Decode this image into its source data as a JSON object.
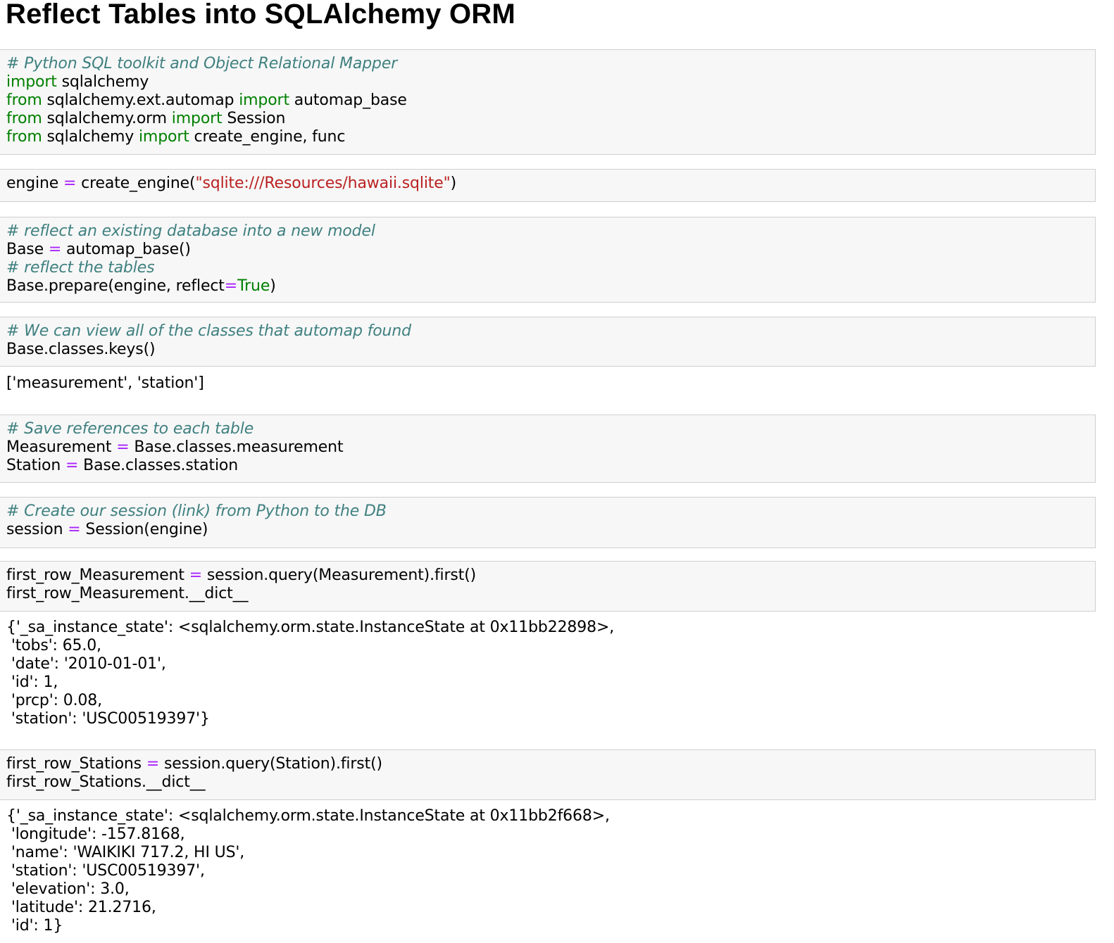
{
  "title": "Reflect Tables into SQLAlchemy ORM",
  "colors": {
    "comment": "#408080",
    "keyword": "#008000",
    "operator": "#aa22ff",
    "string": "#ba2121",
    "cell_background": "#f7f7f7",
    "cell_border": "#cfcfcf"
  },
  "cells": [
    {
      "input": [
        [
          {
            "t": "comment",
            "v": "# Python SQL toolkit and Object Relational Mapper"
          }
        ],
        [
          {
            "t": "kw",
            "v": "import"
          },
          {
            "t": "txt",
            "v": " sqlalchemy"
          }
        ],
        [
          {
            "t": "kw",
            "v": "from"
          },
          {
            "t": "txt",
            "v": " sqlalchemy.ext.automap "
          },
          {
            "t": "kw",
            "v": "import"
          },
          {
            "t": "txt",
            "v": " automap_base"
          }
        ],
        [
          {
            "t": "kw",
            "v": "from"
          },
          {
            "t": "txt",
            "v": " sqlalchemy.orm "
          },
          {
            "t": "kw",
            "v": "import"
          },
          {
            "t": "txt",
            "v": " Session"
          }
        ],
        [
          {
            "t": "kw",
            "v": "from"
          },
          {
            "t": "txt",
            "v": " sqlalchemy "
          },
          {
            "t": "kw",
            "v": "import"
          },
          {
            "t": "txt",
            "v": " create_engine, func"
          }
        ]
      ],
      "output": []
    },
    {
      "input": [
        [
          {
            "t": "txt",
            "v": "engine "
          },
          {
            "t": "op",
            "v": "="
          },
          {
            "t": "txt",
            "v": " create_engine("
          },
          {
            "t": "str",
            "v": "\"sqlite:///Resources/hawaii.sqlite\""
          },
          {
            "t": "txt",
            "v": ")"
          }
        ]
      ],
      "output": []
    },
    {
      "input": [
        [
          {
            "t": "comment",
            "v": "# reflect an existing database into a new model"
          }
        ],
        [
          {
            "t": "txt",
            "v": "Base "
          },
          {
            "t": "op",
            "v": "="
          },
          {
            "t": "txt",
            "v": " automap_base()"
          }
        ],
        [
          {
            "t": "comment",
            "v": "# reflect the tables"
          }
        ],
        [
          {
            "t": "txt",
            "v": "Base.prepare(engine, reflect"
          },
          {
            "t": "op",
            "v": "="
          },
          {
            "t": "kw",
            "v": "True"
          },
          {
            "t": "txt",
            "v": ")"
          }
        ]
      ],
      "output": []
    },
    {
      "input": [
        [
          {
            "t": "comment",
            "v": "# We can view all of the classes that automap found"
          }
        ],
        [
          {
            "t": "txt",
            "v": "Base.classes.keys()"
          }
        ]
      ],
      "output": [
        "['measurement', 'station']"
      ]
    },
    {
      "input": [
        [
          {
            "t": "comment",
            "v": "# Save references to each table"
          }
        ],
        [
          {
            "t": "txt",
            "v": "Measurement "
          },
          {
            "t": "op",
            "v": "="
          },
          {
            "t": "txt",
            "v": " Base.classes.measurement"
          }
        ],
        [
          {
            "t": "txt",
            "v": "Station "
          },
          {
            "t": "op",
            "v": "="
          },
          {
            "t": "txt",
            "v": " Base.classes.station"
          }
        ]
      ],
      "output": []
    },
    {
      "input": [
        [
          {
            "t": "comment",
            "v": "# Create our session (link) from Python to the DB"
          }
        ],
        [
          {
            "t": "txt",
            "v": "session "
          },
          {
            "t": "op",
            "v": "="
          },
          {
            "t": "txt",
            "v": " Session(engine)"
          }
        ]
      ],
      "output": []
    },
    {
      "input": [
        [
          {
            "t": "txt",
            "v": "first_row_Measurement "
          },
          {
            "t": "op",
            "v": "="
          },
          {
            "t": "txt",
            "v": " session.query(Measurement).first()"
          }
        ],
        [
          {
            "t": "txt",
            "v": "first_row_Measurement.__dict__"
          }
        ]
      ],
      "output": [
        "{'_sa_instance_state': <sqlalchemy.orm.state.InstanceState at 0x11bb22898>,",
        " 'tobs': 65.0,",
        " 'date': '2010-01-01',",
        " 'id': 1,",
        " 'prcp': 0.08,",
        " 'station': 'USC00519397'}"
      ]
    },
    {
      "input": [
        [
          {
            "t": "txt",
            "v": "first_row_Stations "
          },
          {
            "t": "op",
            "v": "="
          },
          {
            "t": "txt",
            "v": " session.query(Station).first()"
          }
        ],
        [
          {
            "t": "txt",
            "v": "first_row_Stations.__dict__"
          }
        ]
      ],
      "output": [
        "{'_sa_instance_state': <sqlalchemy.orm.state.InstanceState at 0x11bb2f668>,",
        " 'longitude': -157.8168,",
        " 'name': 'WAIKIKI 717.2, HI US',",
        " 'station': 'USC00519397',",
        " 'elevation': 3.0,",
        " 'latitude': 21.2716,",
        " 'id': 1}"
      ]
    }
  ]
}
